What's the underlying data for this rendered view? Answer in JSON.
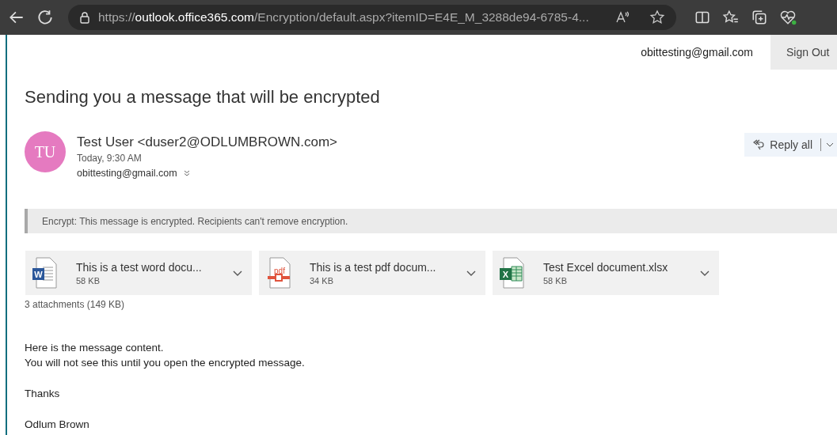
{
  "browser": {
    "url_scheme": "https://",
    "url_host": "outlook.office365.com",
    "url_path": "/Encryption/default.aspx?itemID=E4E_M_3288de94-6785-4..."
  },
  "account": {
    "email": "obittesting@gmail.com",
    "sign_out": "Sign Out"
  },
  "message": {
    "subject": "Sending you a message that will be encrypted",
    "avatar_initials": "TU",
    "sender": "Test User <duser2@ODLUMBROWN.com>",
    "time": "Today, 9:30 AM",
    "recipient": "obittesting@gmail.com",
    "reply_all": "Reply all",
    "notice": "Encrypt: This message is encrypted. Recipients can't remove encryption.",
    "attachments": [
      {
        "kind": "word",
        "icon_label": "W",
        "name": "This is a test word docu...",
        "size": "58 KB"
      },
      {
        "kind": "pdf",
        "icon_label": "pdf",
        "name": "This is a test pdf docum...",
        "size": "34 KB"
      },
      {
        "kind": "excel",
        "icon_label": "X",
        "name": "Test Excel document.xlsx",
        "size": "58 KB"
      }
    ],
    "attachments_summary": "3 attachments (149 KB)",
    "body": [
      [
        "Here is the message content.",
        "You will not see this until you open the encrypted message."
      ],
      [
        "Thanks"
      ],
      [
        "Odlum Brown"
      ]
    ]
  }
}
